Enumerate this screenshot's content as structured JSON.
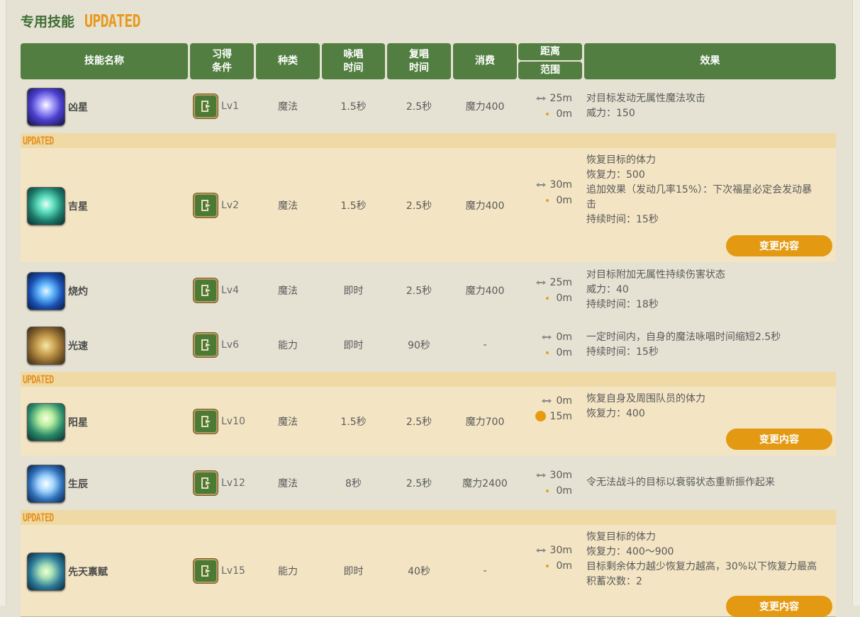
{
  "section": {
    "title": "专用技能",
    "updated_badge": "UPDATED"
  },
  "headers": {
    "name": "技能名称",
    "acquire_1": "习得",
    "acquire_2": "条件",
    "type": "种类",
    "cast_1": "咏唱",
    "cast_2": "时间",
    "recast_1": "复唱",
    "recast_2": "时间",
    "cost": "消费",
    "range": "距离",
    "radius": "范围",
    "effect": "效果"
  },
  "updated_label": "UPDATED",
  "change_label": "变更内容",
  "rows": [
    {
      "name": "凶星",
      "level": "Lv1",
      "type": "魔法",
      "cast": "1.5秒",
      "recast": "2.5秒",
      "cost": "魔力400",
      "range": "25m",
      "radius": "0m",
      "effect": [
        "对目标发动无属性魔法攻击",
        "威力：150"
      ]
    },
    {
      "name": "吉星",
      "level": "Lv2",
      "type": "魔法",
      "cast": "1.5秒",
      "recast": "2.5秒",
      "cost": "魔力400",
      "range": "30m",
      "radius": "0m",
      "effect": [
        "恢复目标的体力",
        "恢复力：500",
        "追加效果（发动几率15%）：下次福星必定会发动暴",
        "击",
        "持续时间：15秒"
      ]
    },
    {
      "name": "烧灼",
      "level": "Lv4",
      "type": "魔法",
      "cast": "即时",
      "recast": "2.5秒",
      "cost": "魔力400",
      "range": "25m",
      "radius": "0m",
      "effect": [
        "对目标附加无属性持续伤害状态",
        "威力：40",
        "持续时间：18秒"
      ]
    },
    {
      "name": "光速",
      "level": "Lv6",
      "type": "能力",
      "cast": "即时",
      "recast": "90秒",
      "cost": "-",
      "range": "0m",
      "radius": "0m",
      "effect": [
        "一定时间内，自身的魔法咏唱时间缩短2.5秒",
        "持续时间：15秒"
      ]
    },
    {
      "name": "阳星",
      "level": "Lv10",
      "type": "魔法",
      "cast": "1.5秒",
      "recast": "2.5秒",
      "cost": "魔力700",
      "range": "0m",
      "radius": "15m",
      "effect": [
        "恢复自身及周围队员的体力",
        "恢复力：400"
      ]
    },
    {
      "name": "生辰",
      "level": "Lv12",
      "type": "魔法",
      "cast": "8秒",
      "recast": "2.5秒",
      "cost": "魔力2400",
      "range": "30m",
      "radius": "0m",
      "effect": [
        "令无法战斗的目标以衰弱状态重新振作起来"
      ]
    },
    {
      "name": "先天禀赋",
      "level": "Lv15",
      "type": "能力",
      "cast": "即时",
      "recast": "40秒",
      "cost": "-",
      "range": "30m",
      "radius": "0m",
      "effect": [
        "恢复目标的体力",
        "恢复力：400～900",
        "目标剩余体力越少恢复力越高，30%以下恢复力最高",
        "积蓄次数：2"
      ]
    }
  ]
}
